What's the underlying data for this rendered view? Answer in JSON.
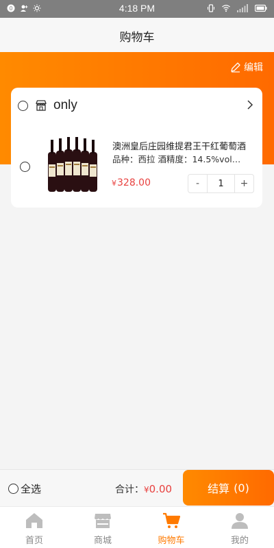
{
  "status_bar": {
    "time": "4:18 PM"
  },
  "header": {
    "title": "购物车",
    "edit_label": "编辑"
  },
  "cart": {
    "shop_name": "only",
    "item": {
      "name": "澳洲皇后庄园维提君王干红葡萄酒",
      "spec": "品种：西拉 酒精度：14.5%vol…",
      "currency_symbol": "¥",
      "price": "328.00",
      "quantity": "1",
      "minus_label": "-",
      "plus_label": "+"
    }
  },
  "checkout": {
    "select_all_label": "全选",
    "total_label": "合计：",
    "currency_symbol": "¥",
    "total_amount": "0.00",
    "button_label": "结算",
    "button_count": "(0)"
  },
  "tabs": [
    {
      "label": "首页",
      "icon": "home-icon",
      "active": false
    },
    {
      "label": "商城",
      "icon": "store-icon",
      "active": false
    },
    {
      "label": "购物车",
      "icon": "cart-icon",
      "active": true
    },
    {
      "label": "我的",
      "icon": "user-icon",
      "active": false
    }
  ],
  "colors": {
    "accent": "#ff7a00",
    "price": "#e8413f"
  }
}
